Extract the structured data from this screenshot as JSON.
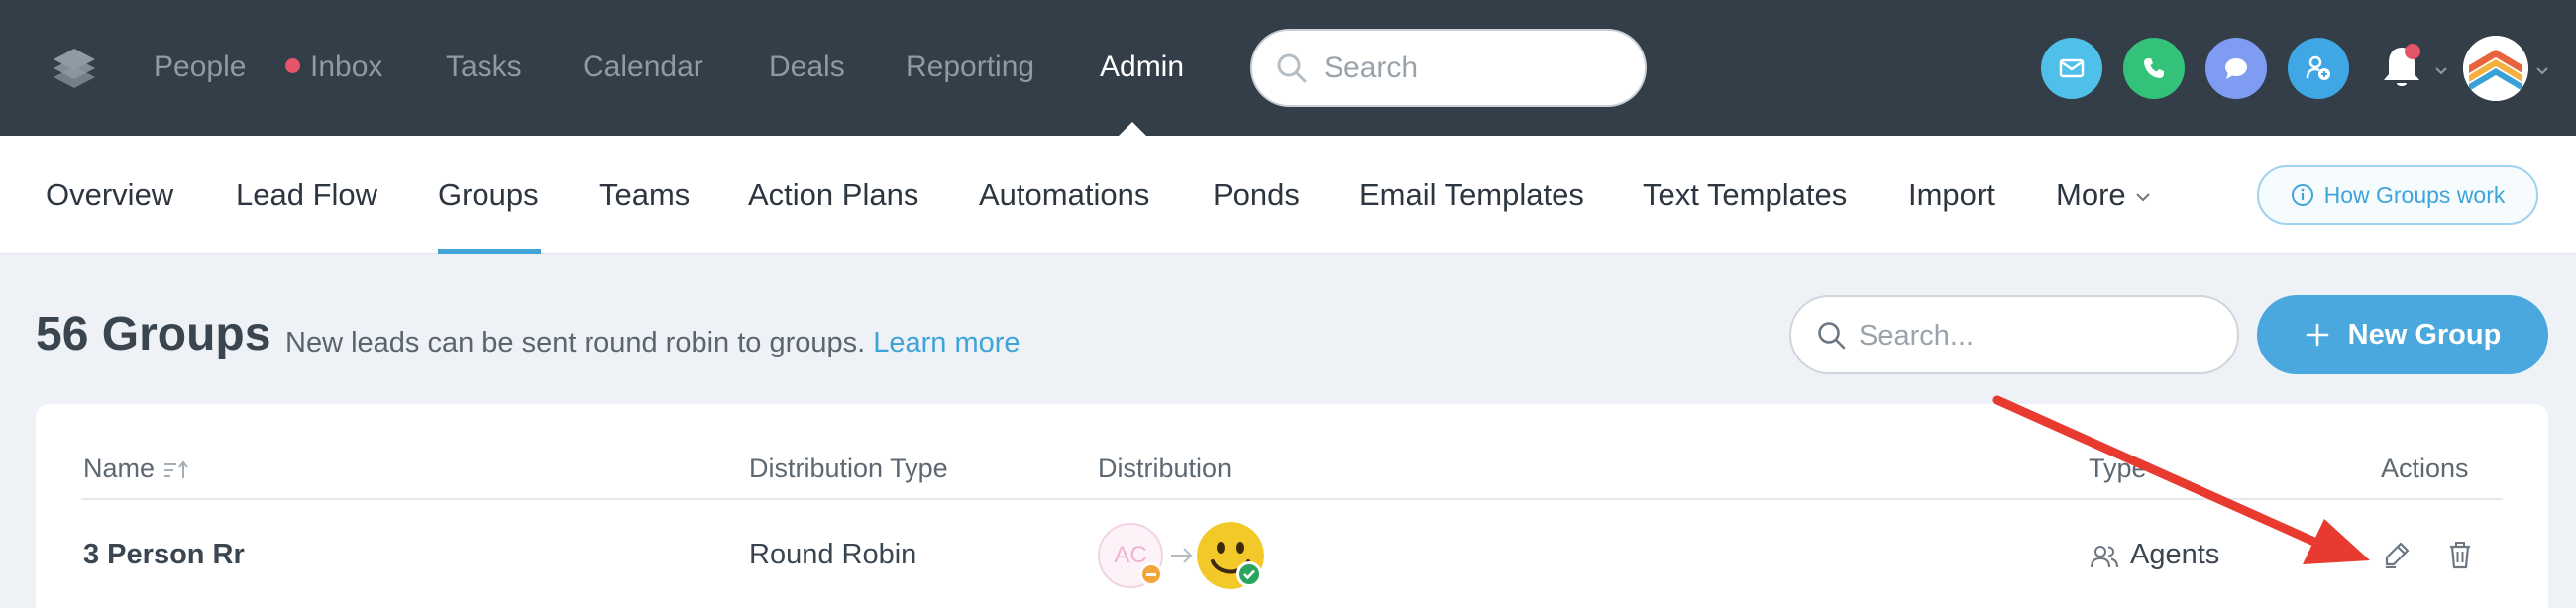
{
  "topnav": {
    "items": [
      {
        "label": "People",
        "active": false
      },
      {
        "label": "Inbox",
        "active": false,
        "dot": true
      },
      {
        "label": "Tasks",
        "active": false
      },
      {
        "label": "Calendar",
        "active": false
      },
      {
        "label": "Deals",
        "active": false
      },
      {
        "label": "Reporting",
        "active": false
      },
      {
        "label": "Admin",
        "active": true
      }
    ],
    "search_placeholder": "Search",
    "quick_actions": [
      {
        "icon": "mail-icon",
        "color": "#4fc0ea"
      },
      {
        "icon": "phone-icon",
        "color": "#34c27a"
      },
      {
        "icon": "chat-icon",
        "color": "#7e9cf2"
      },
      {
        "icon": "add-person-icon",
        "color": "#3fa7e3"
      }
    ]
  },
  "subnav": {
    "items": [
      "Overview",
      "Lead Flow",
      "Groups",
      "Teams",
      "Action Plans",
      "Automations",
      "Ponds",
      "Email Templates",
      "Text Templates",
      "Import",
      "More"
    ],
    "active": "Groups",
    "help_label": "How Groups work"
  },
  "page": {
    "title": "56 Groups",
    "subtitle": "New leads can be sent round robin to groups.",
    "learn_more": "Learn more",
    "search_placeholder": "Search...",
    "new_button": "New Group"
  },
  "table": {
    "columns": {
      "name": "Name",
      "distribution_type": "Distribution Type",
      "distribution": "Distribution",
      "type": "Type",
      "actions": "Actions"
    },
    "rows": [
      {
        "name": "3 Person Rr",
        "distribution_type": "Round Robin",
        "distribution": {
          "first_initials": "AC",
          "first_status": "away",
          "second_status": "available"
        },
        "type": "Agents"
      }
    ]
  }
}
